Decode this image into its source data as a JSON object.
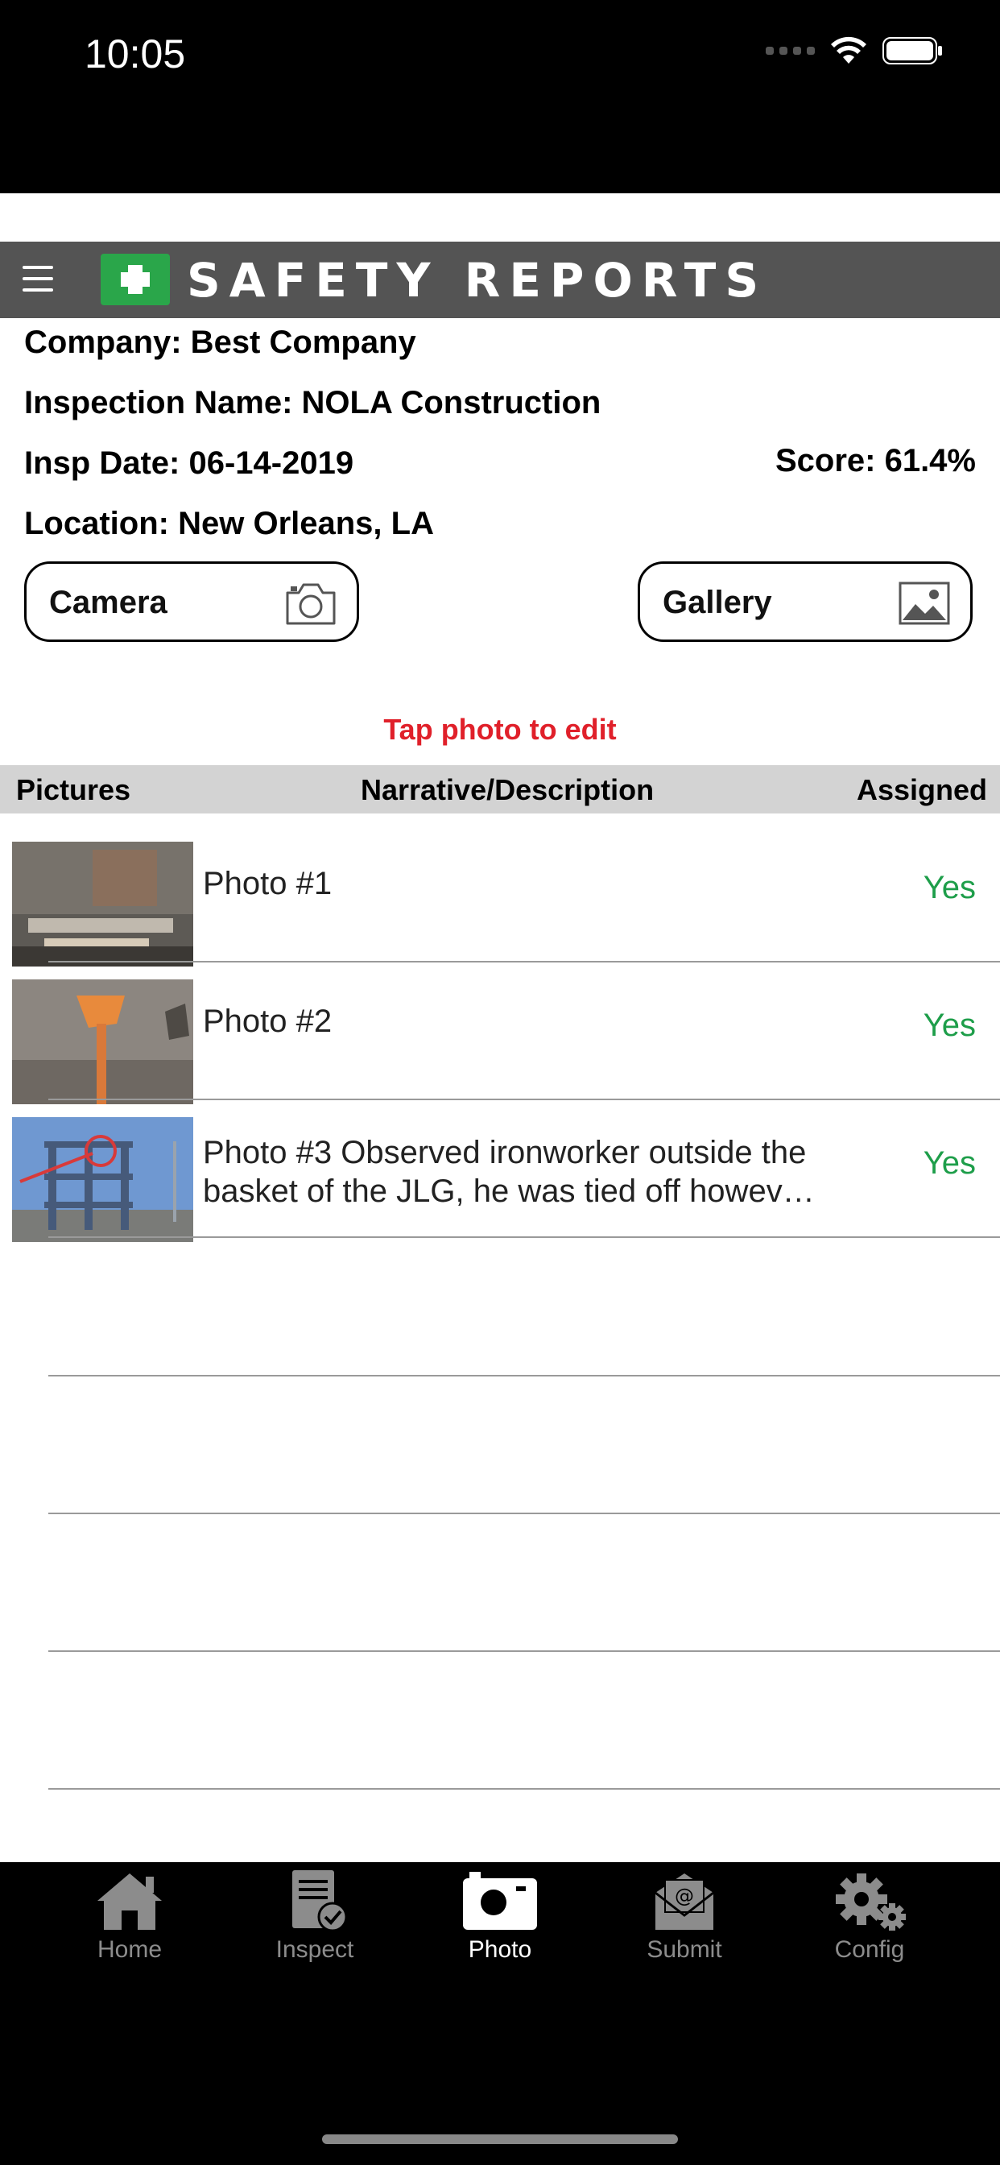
{
  "status_bar": {
    "time": "10:05"
  },
  "app": {
    "title": "SAFETY REPORTS"
  },
  "inspection": {
    "company": "Company: Best Company",
    "name": "Inspection Name: NOLA Construction",
    "date": "Insp Date: 06-14-2019",
    "score": "Score: 61.4%",
    "location": "Location: New Orleans, LA"
  },
  "buttons": {
    "camera": "Camera",
    "gallery": "Gallery"
  },
  "hint": "Tap photo to edit",
  "table": {
    "headers": [
      "Pictures",
      "Narrative/Description",
      "Assigned"
    ],
    "rows": [
      {
        "description": "Photo #1",
        "assigned": "Yes"
      },
      {
        "description": "Photo #2",
        "assigned": "Yes"
      },
      {
        "description": "Photo #3 Observed ironworker outside the basket of the JLG, he was tied off howev…",
        "assigned": "Yes"
      }
    ]
  },
  "tabs": [
    {
      "label": "Home",
      "icon": "home-icon"
    },
    {
      "label": "Inspect",
      "icon": "clipboard-check-icon"
    },
    {
      "label": "Photo",
      "icon": "camera-icon"
    },
    {
      "label": "Submit",
      "icon": "envelope-icon"
    },
    {
      "label": "Config",
      "icon": "gears-icon"
    }
  ],
  "colors": {
    "accent_green": "#2aa64a",
    "assigned_green": "#1e9e4a",
    "hint_red": "#e0202a",
    "appbar": "#545454"
  }
}
